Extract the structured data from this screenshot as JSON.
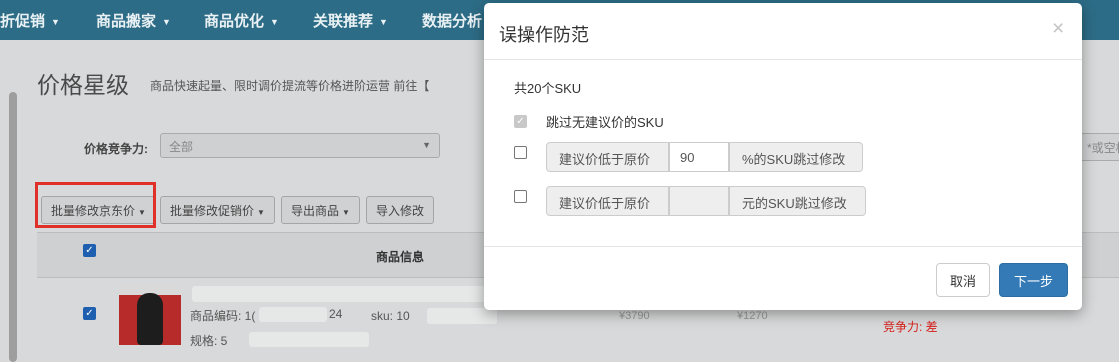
{
  "topnav": {
    "items": [
      {
        "label": "折促销"
      },
      {
        "label": "商品搬家"
      },
      {
        "label": "商品优化"
      },
      {
        "label": "关联推荐"
      },
      {
        "label": "数据分析"
      }
    ]
  },
  "page": {
    "title": "价格星级",
    "description": "商品快速起量、限时调价提流等价格进阶运营 前往【"
  },
  "filter": {
    "label": "价格竞争力:",
    "value": "全部",
    "right_placeholder": "*或空格"
  },
  "toolbar": {
    "batch_jd_price": "批量修改京东价",
    "batch_promo_price": "批量修改促销价",
    "export": "导出商品",
    "import": "导入修改"
  },
  "table": {
    "product_info_header": "商品信息",
    "row": {
      "product_code_label": "商品编码: 1(",
      "product_code_tail": "24",
      "spec_label": "规格: 5",
      "sku_label": "sku: 10",
      "price_a": "¥3790",
      "price_b": "¥1270",
      "compete": "竞争力: 差"
    }
  },
  "modal": {
    "title": "误操作防范",
    "close": "×",
    "sku_count": "共20个SKU",
    "option_skip_no_price": "跳过无建议价的SKU",
    "option_percent": {
      "prefix": "建议价低于原价",
      "value": "90",
      "suffix": "%的SKU跳过修改"
    },
    "option_amount": {
      "prefix": "建议价低于原价",
      "value": "",
      "suffix": "元的SKU跳过修改"
    },
    "cancel": "取消",
    "next": "下一步"
  },
  "colors": {
    "nav_bg": "#2d6c86",
    "primary": "#337ab7",
    "highlight": "#e0302a",
    "danger_text": "#d6201a"
  }
}
